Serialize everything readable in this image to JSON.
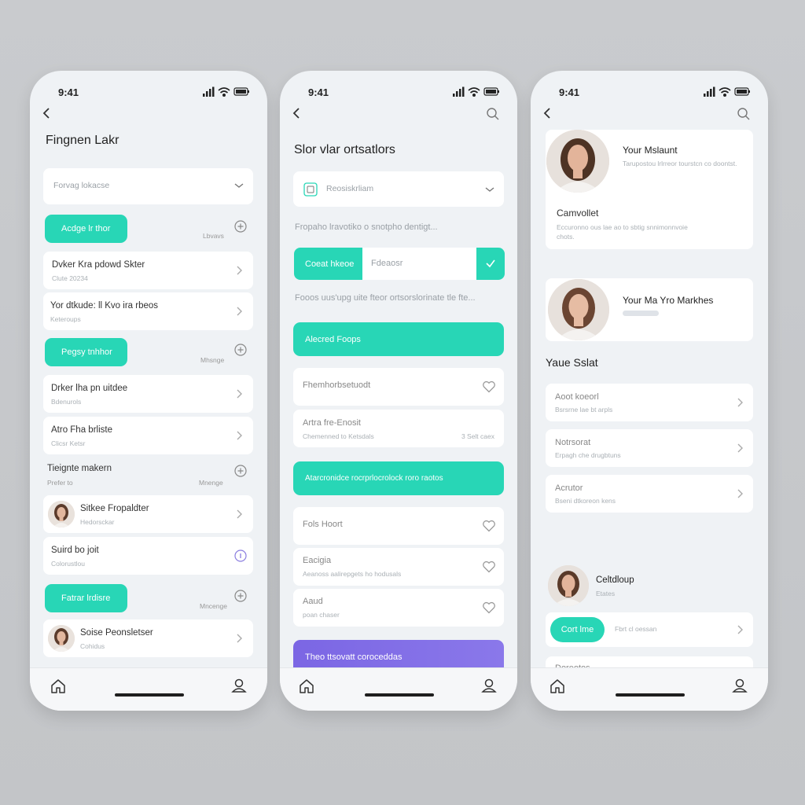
{
  "status": {
    "time": "9:41"
  },
  "icons": {
    "back": "chevron-left-icon",
    "search": "search-icon",
    "home": "home-icon",
    "profile": "person-icon",
    "signal": "signal-icon",
    "wifi": "wifi-icon",
    "battery": "battery-icon"
  },
  "colors": {
    "accent": "#28d6b6",
    "purple": "#7b66e4",
    "background": "#eff2f5"
  },
  "screen1": {
    "title": "Fingnen Lakr",
    "dropdown": "Forvag lokacse",
    "sections": [
      {
        "button": "Acdge lr thor",
        "side": "Lbvavs"
      },
      {
        "button": "Pegsy tnhhor",
        "side": "Mhsnge"
      },
      {
        "heading": "Tieignte makern",
        "sub": "Prefer to",
        "side": "Mnenge"
      },
      {
        "button": "Fatrar lrdisre",
        "side": "Mncenge"
      }
    ],
    "rows": [
      {
        "title": "Dvker Kra pdowd Skter",
        "sub": "Clute 20234"
      },
      {
        "title": "Yor dtkude: ll Kvo ira rbeos",
        "sub": "Keteroups"
      },
      {
        "title": "Drker lha pn uitdee",
        "sub": "Bdenurols"
      },
      {
        "title": "Atro Fha brliste",
        "sub": "Clicsr Ketsr"
      },
      {
        "title": "Sitkee Fropaldter",
        "sub": "Hedorsckar"
      },
      {
        "title": "Suird bo joit",
        "sub": "Colorustlou"
      },
      {
        "title": "Soise Peonsletser",
        "sub": "Cohidus"
      }
    ]
  },
  "screen2": {
    "title": "Slor vlar ortsatlors",
    "dropdown": "Reosiskrliam",
    "hint1": "Fropaho lravotiko o snotpho dentigt...",
    "segment_btn": "Coeat hkeoe",
    "segment_input": "Fdeaosr",
    "hint2": "Fooos uus'upg uite fteor ortsorslorinate tle fte...",
    "accent1": "Alecred Foops",
    "rows1": [
      {
        "title": "Fhemhorbsetuodt",
        "sub": ""
      },
      {
        "title": "Artra fre-Enosit",
        "sub": "Chemenned to Ketsdals",
        "side": "3 Selt caex"
      }
    ],
    "accent2": "Atarcronidce rocrprlocrolock roro raotos",
    "rows2": [
      {
        "title": "Fols Hoort",
        "sub": ""
      },
      {
        "title": "Eacigia",
        "sub": "Aeanoss aalirepgets ho hodusals"
      },
      {
        "title": "Aaud",
        "sub": "poan chaser"
      }
    ],
    "purple": "Theo ttsovatt coroceddas"
  },
  "screen3": {
    "profile1": {
      "name": "Your Mslaunt",
      "desc": "Tarupostou lrlrreor tourstcn co doontst."
    },
    "section1": {
      "title": "Camvollet",
      "desc": "Eccuronno ous lae ao to sbtig snnimonnvoie chots."
    },
    "profile2": {
      "name": "Your Ma Yro Markhes"
    },
    "heading": "Yaue Sslat",
    "rows": [
      {
        "title": "Aoot koeorl",
        "sub": "Bsrsrne lae bt arpls"
      },
      {
        "title": "Notrsorat",
        "sub": "Erpagh che drugbtuns"
      },
      {
        "title": "Acrutor",
        "sub": "Bseni dtkoreon kens"
      }
    ],
    "profile3": {
      "name": "Celtdloup",
      "sub": "Etates"
    },
    "button": "Cort lme",
    "button_side": "Fbrt cl oessan",
    "last_row": "Doreotos"
  }
}
